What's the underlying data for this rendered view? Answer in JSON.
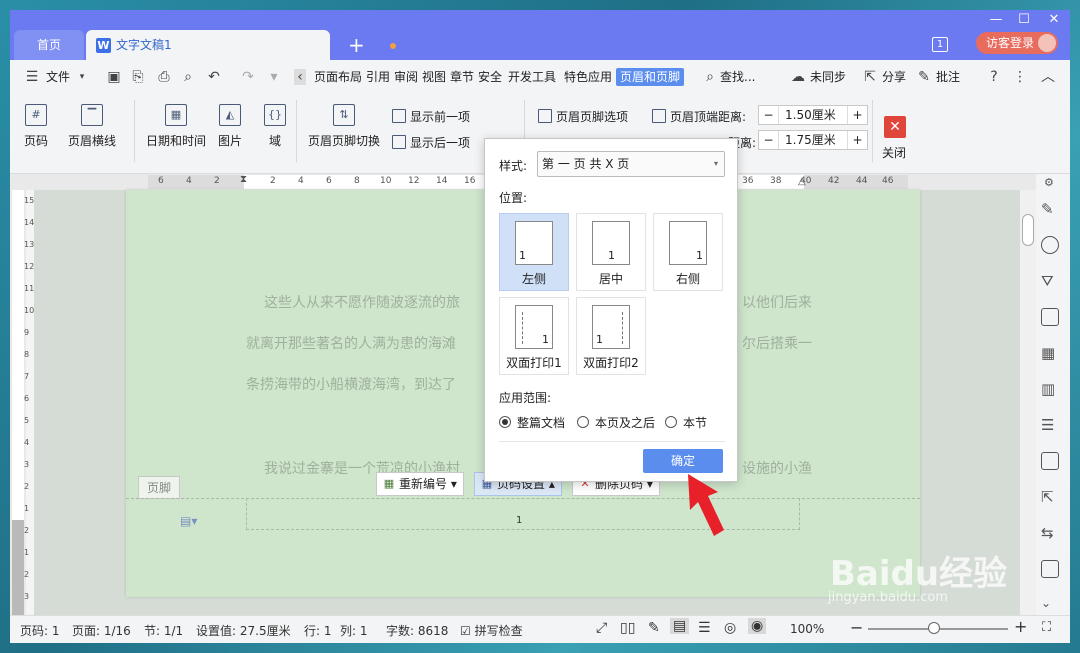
{
  "tabs": {
    "home": "首页",
    "doc": "文字文稿1"
  },
  "title_right": {
    "badge": "1",
    "login": "访客登录"
  },
  "menu": {
    "file": "文件",
    "items": [
      "页面布局",
      "引用",
      "审阅",
      "视图",
      "章节",
      "安全",
      "开发工具",
      "特色应用",
      "页眉和页脚"
    ],
    "search": "查找...",
    "sync": "未同步",
    "share": "分享",
    "annotate": "批注"
  },
  "ribbon": {
    "page_num": "页码",
    "header_line": "页眉横线",
    "datetime": "日期和时间",
    "picture": "图片",
    "field": "域",
    "switch": "页眉页脚切换",
    "show_prev": "显示前一项",
    "show_next": "显示后一项",
    "options": "页眉页脚选项",
    "top_dist_label": "页眉顶端距离:",
    "top_dist_value": "1.50厘米",
    "bottom_dist_label": "距离:",
    "bottom_dist_value": "1.75厘米",
    "close": "关闭"
  },
  "ruler": {
    "left_nums": [
      "6",
      "4",
      "2",
      "2"
    ],
    "nums": [
      "4",
      "6",
      "8",
      "10",
      "12",
      "14",
      "16",
      "18"
    ],
    "right_nums": [
      "36",
      "38",
      "40",
      "42",
      "44",
      "46"
    ]
  },
  "vruler": [
    "15",
    "14",
    "13",
    "12",
    "11",
    "10",
    "9",
    "8",
    "7",
    "6",
    "5",
    "4",
    "3",
    "2",
    "1",
    "2",
    "1",
    "2",
    "3"
  ],
  "document": {
    "lines": [
      "这些人从来不愿作随波逐流的旅",
      "以他们后来",
      "就离开那些著名的人满为患的海滩",
      "尔后搭乘一",
      "条捞海带的小船横渡海湾，到达了",
      "我说过金寨是一个荒凉的小渔村",
      "设施的小渔"
    ],
    "footer_tag": "页脚",
    "footer_page": "1"
  },
  "footer_buttons": {
    "renumber": "重新编号",
    "settings": "页码设置",
    "delete": "删除页码"
  },
  "dialog": {
    "style_label": "样式:",
    "style_value": "第 一 页 共 X 页",
    "position_label": "位置:",
    "positions": [
      "左侧",
      "居中",
      "右侧",
      "双面打印1",
      "双面打印2"
    ],
    "page_num": "1",
    "scope_label": "应用范围:",
    "scopes": [
      "整篇文档",
      "本页及之后",
      "本节"
    ],
    "ok": "确定"
  },
  "status": {
    "page_code": "页码: 1",
    "pages": "页面: 1/16",
    "section": "节: 1/1",
    "setting": "设置值: 27.5厘米",
    "row": "行: 1",
    "col": "列: 1",
    "words": "字数: 8618",
    "spell": "拼写检查",
    "zoom": "100%"
  },
  "watermark": {
    "brand": "Baidu经验",
    "url": "jingyan.baidu.com"
  }
}
